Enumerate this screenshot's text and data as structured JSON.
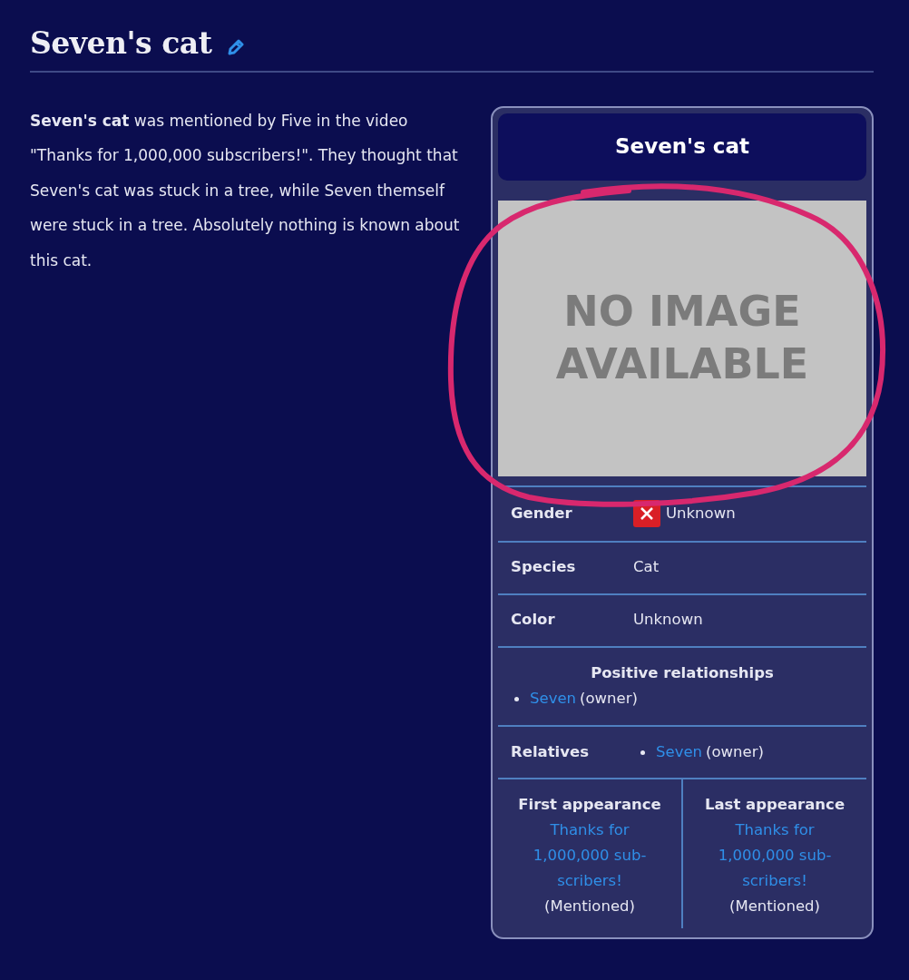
{
  "page": {
    "title": "Seven's cat"
  },
  "intro": "**Seven's cat** was mentioned by Five in the video \"Thanks for 1,000,000 subscribers!\". They thought that Seven's cat was stuck in a tree, while Seven themself were stuck in a tree. Absolutely nothing is known about this cat.",
  "infobox": {
    "title": "Seven's cat",
    "image": {
      "kind": "placeholder",
      "text": "NO IMAGE AVAILABLE"
    },
    "rows": [
      {
        "kind": "flagged",
        "label": "Gender",
        "value": "Unknown"
      },
      {
        "kind": "field",
        "label": "Species",
        "value": "Cat"
      },
      {
        "kind": "field",
        "label": "Color",
        "value": "Unknown"
      },
      {
        "kind": "section",
        "label": "Positive relationships",
        "items": [
          {
            "link": "Seven",
            "note": "(owner)"
          }
        ]
      },
      {
        "kind": "list",
        "label": "Relatives",
        "items": [
          {
            "link": "Seven",
            "note": "(owner)"
          }
        ]
      }
    ],
    "appearances": [
      {
        "label": "First appearance",
        "link": "Thanks for 1,000,000 sub-scribers!",
        "note": "(Mentioned)"
      },
      {
        "label": "Last appearance",
        "link": "Thanks for 1,000,000 sub-scribers!",
        "note": "(Mentioned)"
      }
    ]
  }
}
